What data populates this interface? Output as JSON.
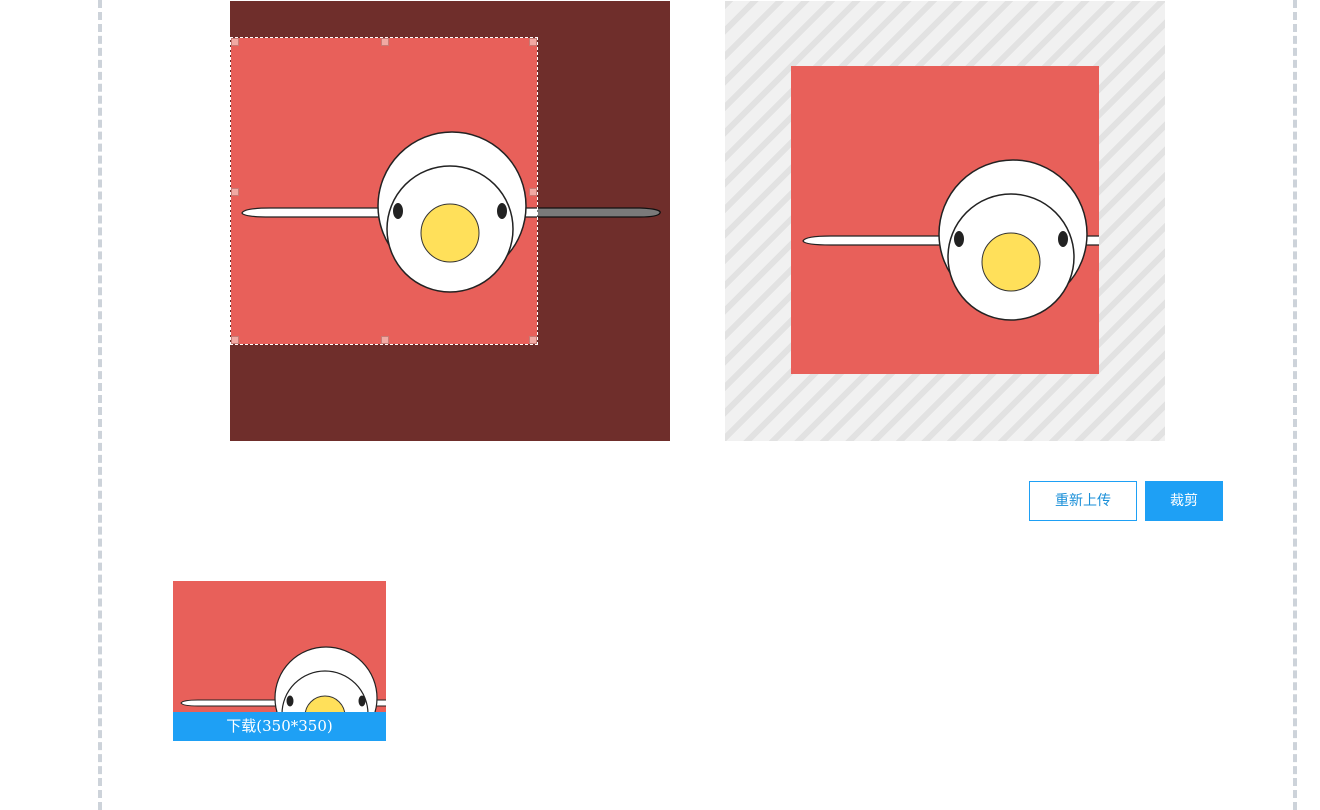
{
  "buttons": {
    "reupload_label": "重新上传",
    "crop_label": "裁剪"
  },
  "result": {
    "download_label": "下载(350*350)"
  },
  "icons": {
    "source_image": "cartoon-egg-face-image",
    "preview_image": "cartoon-egg-face-preview",
    "result_image": "cartoon-egg-face-thumbnail"
  },
  "colors": {
    "accent": "#1ea0f5",
    "image_background": "#e8605a",
    "egg_yolk": "#ffe05a",
    "frame_border": "#cdd3da"
  }
}
